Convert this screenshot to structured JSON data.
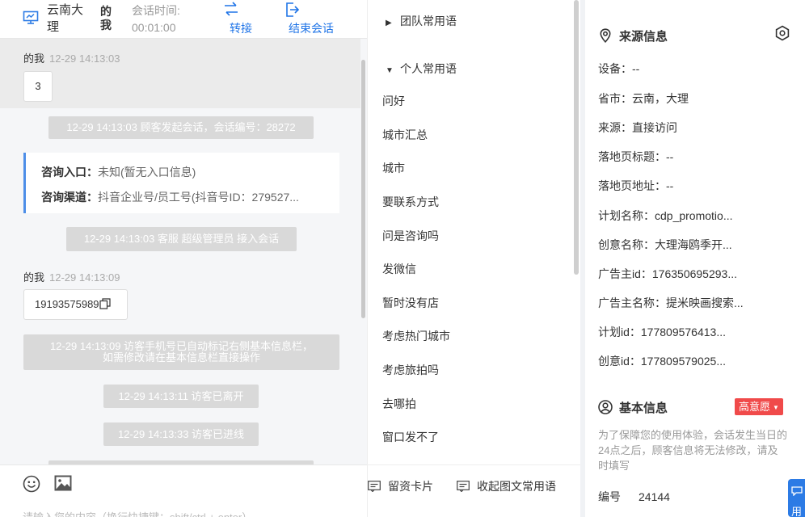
{
  "header": {
    "visitor_name": "云南大理",
    "agent_label": "的我",
    "session_time_label": "会话时间:",
    "session_time_value": "00:01:00",
    "transfer_label": "转接",
    "end_label": "结束会话"
  },
  "messages": {
    "msg1_sender": "的我",
    "msg1_time": "12-29 14:13:03",
    "msg1_text": "3",
    "sys1": "12-29 14:13:03 顾客发起会话，会话编号：28272",
    "consult_entry_label": "咨询入口：",
    "consult_entry_value": "未知(暂无入口信息)",
    "consult_channel_label": "咨询渠道：",
    "consult_channel_value": "抖音企业号/员工号(抖音号ID：279527...",
    "sys2": "12-29 14:13:03 客服 超级管理员 接入会话",
    "msg2_sender": "的我",
    "msg2_time": "12-29 14:13:09",
    "msg2_text": "19193575989",
    "sys3_line1": "12-29 14:13:09 访客手机号已自动标记右侧基本信息栏，",
    "sys3_line2": "如需修改请在基本信息栏直接操作",
    "sys4": "12-29 14:13:11 访客已离开",
    "sys5": "12-29 14:13:33 访客已进线"
  },
  "input": {
    "placeholder": "请输入您的内容（换行快捷键：shift/ctrl + enter）"
  },
  "phrases": {
    "team_group": "团队常用语",
    "personal_group": "个人常用语",
    "items": [
      "问好",
      "城市汇总",
      "城市",
      "要联系方式",
      "问是咨询吗",
      "发微信",
      "暂时没有店",
      "考虑热门城市",
      "考虑旅拍吗",
      "去哪拍",
      "窗口发不了"
    ],
    "card_button": "留资卡片",
    "collapse_button": "收起图文常用语"
  },
  "source_info": {
    "title": "来源信息",
    "rows": [
      "设备：--",
      "省市：云南，大理",
      "来源：直接访问",
      "落地页标题：--",
      "落地页地址：--",
      "计划名称：cdp_promotio...",
      "创意名称：大理海鸥季开...",
      "广告主id：176350695293...",
      "广告主名称：提米映画搜索...",
      "计划id：177809576413...",
      "创意id：177809579025..."
    ]
  },
  "basic_info": {
    "title": "基本信息",
    "intent_badge": "高意愿",
    "notice": "为了保障您的使用体验，会话发生当日的24点之后，顾客信息将无法修改，请及时填写",
    "id_label": "编号",
    "id_value": "24144"
  },
  "float_button": {
    "label": "用"
  },
  "colors": {
    "accent": "#1f74e7",
    "intent_red": "#f04a4a",
    "system_msg_bg": "#d9d9d9"
  }
}
